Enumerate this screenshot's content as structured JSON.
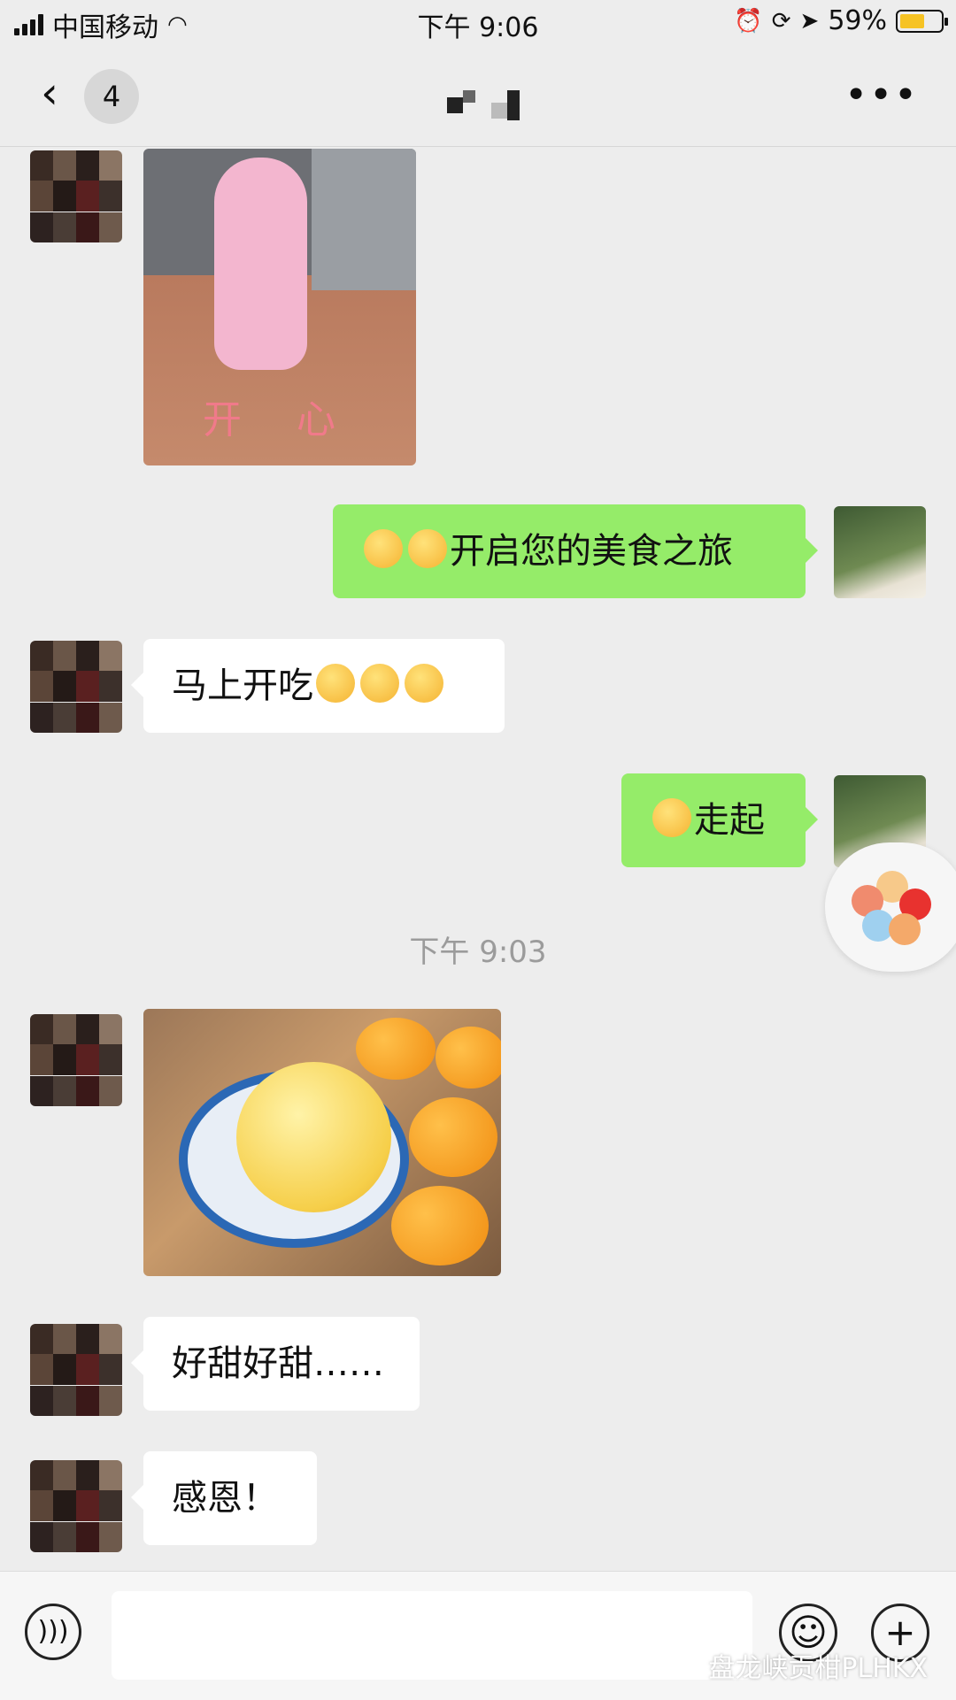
{
  "status_bar": {
    "carrier": "中国移动",
    "time": "下午 9:06",
    "battery": "59%",
    "battery_level": 0.59
  },
  "nav": {
    "back_badge": "4"
  },
  "messages": [
    {
      "from": "them",
      "type": "image",
      "caption": "开 心"
    },
    {
      "from": "me",
      "type": "text",
      "text": "开启您的美食之旅",
      "emoji_count": 2
    },
    {
      "from": "them",
      "type": "text",
      "text": "马上开吃",
      "emoji_count": 3
    },
    {
      "from": "me",
      "type": "text",
      "text": "走起",
      "emoji_count": 1
    },
    {
      "from": "them",
      "type": "image"
    },
    {
      "from": "them",
      "type": "text",
      "text": "好甜好甜……"
    },
    {
      "from": "them",
      "type": "text",
      "text": "感恩！"
    }
  ],
  "timestamp": "下午 9:03",
  "watermark": "盘龙峡贡柑PLHKX",
  "colors": {
    "my_bubble": "#95ec69",
    "their_bubble": "#ffffff",
    "background": "#ededed"
  }
}
